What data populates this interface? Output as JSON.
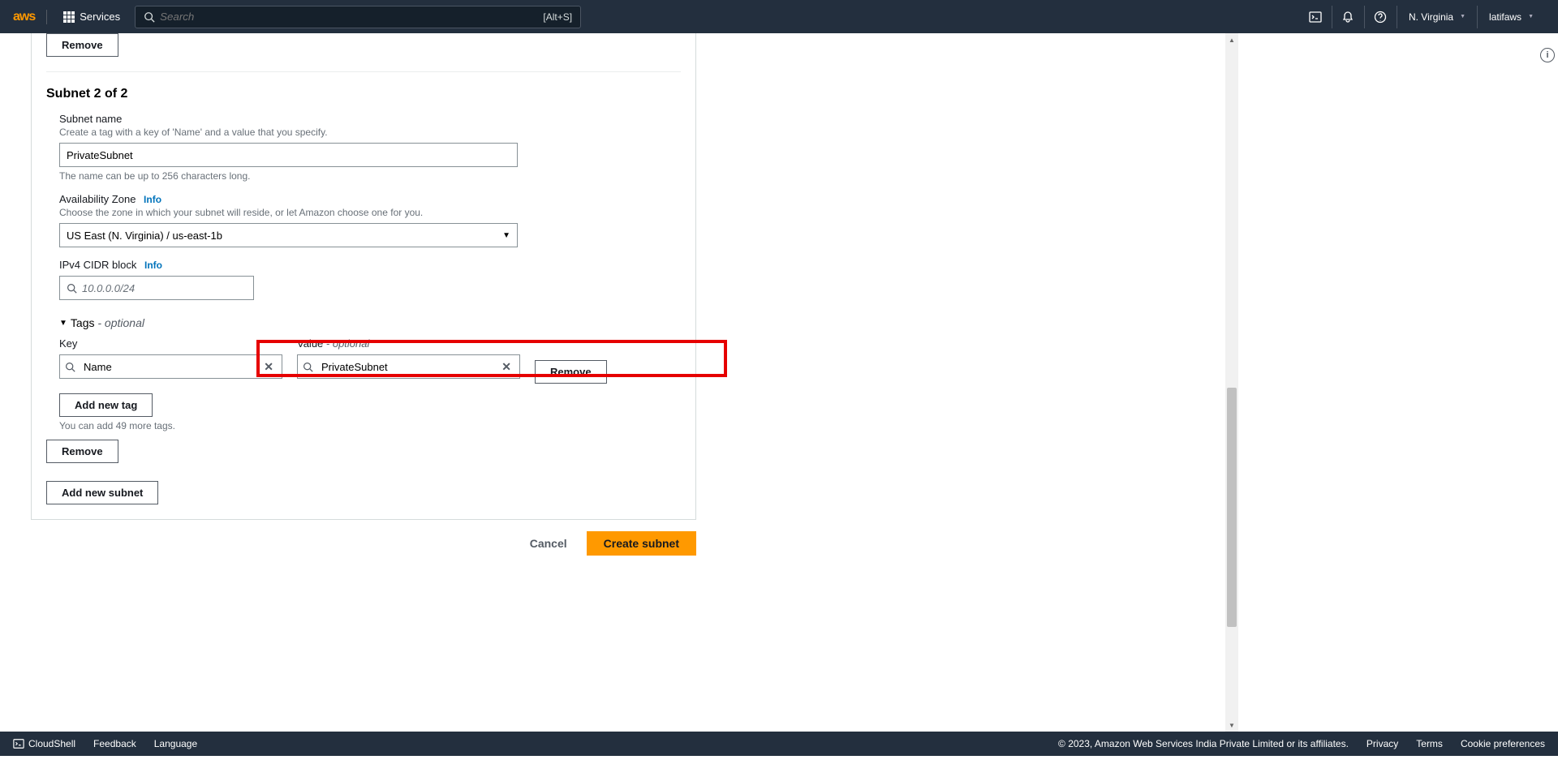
{
  "nav": {
    "logo_text": "aws",
    "services": "Services",
    "search_placeholder": "Search",
    "search_hint": "[Alt+S]",
    "region": "N. Virginia",
    "user": "latifaws"
  },
  "form": {
    "remove_subnet1_label": "Remove",
    "subnet_heading": "Subnet 2 of 2",
    "subnet_name_label": "Subnet name",
    "subnet_name_desc": "Create a tag with a key of 'Name' and a value that you specify.",
    "subnet_name_value": "PrivateSubnet",
    "subnet_name_help": "The name can be up to 256 characters long.",
    "az_label": "Availability Zone",
    "az_info": "Info",
    "az_desc": "Choose the zone in which your subnet will reside, or let Amazon choose one for you.",
    "az_value": "US East (N. Virginia) / us-east-1b",
    "cidr_label": "IPv4 CIDR block",
    "cidr_info": "Info",
    "cidr_placeholder": "10.0.0.0/24",
    "tags_label": "Tags ",
    "tags_optional": "- optional",
    "key_label": "Key",
    "value_label": "Value ",
    "value_optional": "- optional",
    "tag_key_value": "Name",
    "tag_value_value": "PrivateSubnet",
    "tag_remove_label": "Remove",
    "add_tag_label": "Add new tag",
    "add_tag_help": "You can add 49 more tags.",
    "remove_subnet2_label": "Remove",
    "add_subnet_label": "Add new subnet"
  },
  "actions": {
    "cancel": "Cancel",
    "create": "Create subnet"
  },
  "footer": {
    "cloudshell": "CloudShell",
    "feedback": "Feedback",
    "language": "Language",
    "copyright": "© 2023, Amazon Web Services India Private Limited or its affiliates.",
    "privacy": "Privacy",
    "terms": "Terms",
    "cookies": "Cookie preferences"
  }
}
